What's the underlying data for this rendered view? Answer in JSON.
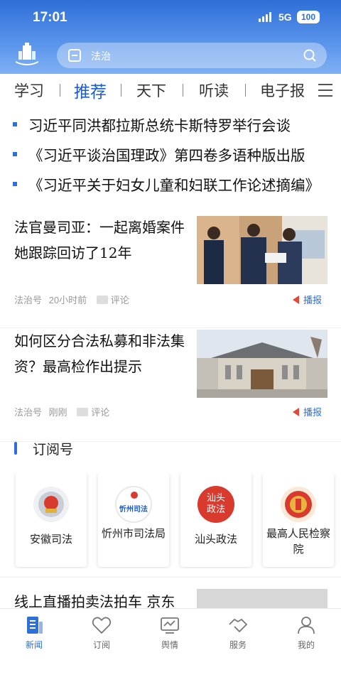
{
  "status_bar": {
    "time": "17:01",
    "network": "5G",
    "battery": "100"
  },
  "search": {
    "placeholder": "法治"
  },
  "tabs": [
    {
      "label": "学习",
      "active": false
    },
    {
      "label": "推荐",
      "active": true
    },
    {
      "label": "天下",
      "active": false
    },
    {
      "label": "听读",
      "active": false
    },
    {
      "label": "电子报",
      "active": false
    }
  ],
  "headlines": [
    "习近平同洪都拉斯总统卡斯特罗举行会谈",
    "《习近平谈治国理政》第四卷多语种版出版",
    "《习近平关于妇女儿童和妇联工作论述摘编》"
  ],
  "articles": [
    {
      "title": "法官曼司亚：一起离婚案件她跟踪回访了12年",
      "source": "法治号",
      "time": "20小时前",
      "comment_label": "评论",
      "broadcast_label": "播报"
    },
    {
      "title": "如何区分合法私募和非法集资？最高检作出提示",
      "source": "法治号",
      "time": "刚刚",
      "comment_label": "评论",
      "broadcast_label": "播报"
    }
  ],
  "subscriptions": {
    "title": "订阅号",
    "items": [
      {
        "name": "安徽司法"
      },
      {
        "name": "忻州市司法局",
        "badge": "忻州司法"
      },
      {
        "name": "汕头政法",
        "badge": "汕头政法"
      },
      {
        "name": "最高人民检察院"
      }
    ]
  },
  "bottom_article": {
    "title": "线上直播拍卖法拍车 京东"
  },
  "tabbar": [
    {
      "label": "新闻",
      "active": true
    },
    {
      "label": "订阅",
      "active": false
    },
    {
      "label": "舆情",
      "active": false
    },
    {
      "label": "服务",
      "active": false
    },
    {
      "label": "我的",
      "active": false
    }
  ],
  "colors": {
    "brand": "#2f6fd8",
    "broadcast_icon": "#e04a3a"
  }
}
